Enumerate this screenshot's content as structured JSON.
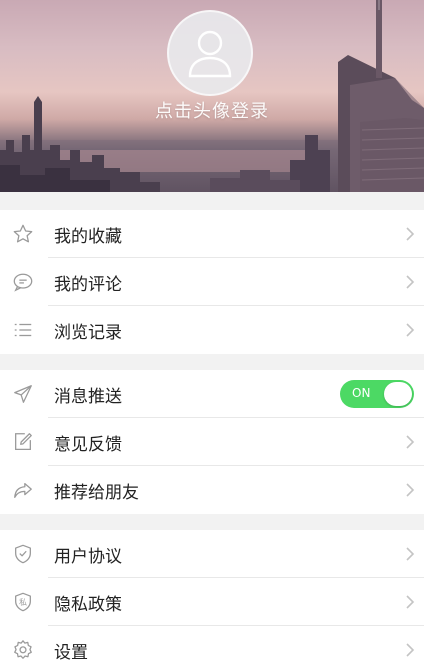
{
  "header": {
    "login_text": "点击头像登录"
  },
  "groups": [
    {
      "items": [
        {
          "label": "我的收藏",
          "icon": "star-icon"
        },
        {
          "label": "我的评论",
          "icon": "comment-icon"
        },
        {
          "label": "浏览记录",
          "icon": "list-icon"
        }
      ]
    },
    {
      "items": [
        {
          "label": "消息推送",
          "icon": "send-icon",
          "toggle": {
            "text": "ON",
            "state": "on"
          }
        },
        {
          "label": "意见反馈",
          "icon": "edit-icon"
        },
        {
          "label": "推荐给朋友",
          "icon": "share-icon"
        }
      ]
    },
    {
      "items": [
        {
          "label": "用户协议",
          "icon": "shield-check-icon"
        },
        {
          "label": "隐私政策",
          "icon": "privacy-shield-icon",
          "icon_text": "私"
        },
        {
          "label": "设置",
          "icon": "gear-icon"
        }
      ]
    }
  ],
  "colors": {
    "toggle_on": "#4cd964",
    "icon": "#9a9a9a",
    "chevron": "#c4c4c4"
  }
}
